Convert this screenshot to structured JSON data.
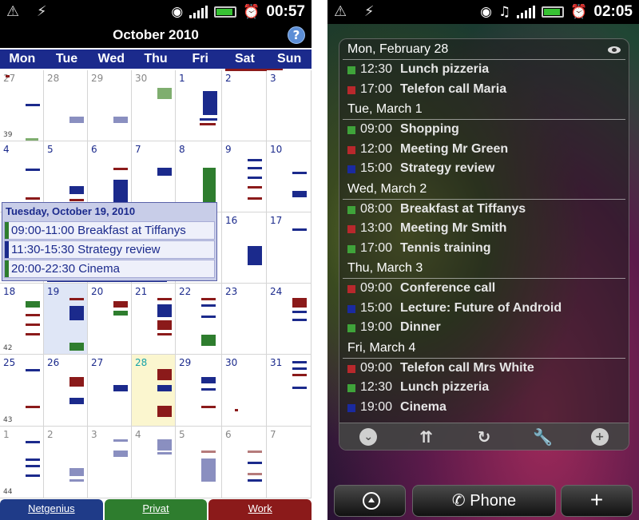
{
  "left": {
    "status": {
      "time": "00:57"
    },
    "month_title": "October 2010",
    "help_label": "?",
    "weekdays": [
      "Mon",
      "Tue",
      "Wed",
      "Thu",
      "Fri",
      "Sat",
      "Sun"
    ],
    "rows": [
      {
        "week": "39",
        "days": [
          "27",
          "28",
          "29",
          "30",
          "1",
          "2",
          "3"
        ]
      },
      {
        "week": "",
        "days": [
          "4",
          "5",
          "6",
          "7",
          "8",
          "9",
          "10"
        ]
      },
      {
        "week": "",
        "days": [
          "",
          "",
          "",
          "",
          "",
          "16",
          "17"
        ]
      },
      {
        "week": "42",
        "days": [
          "18",
          "19",
          "20",
          "21",
          "22",
          "23",
          "24"
        ]
      },
      {
        "week": "43",
        "days": [
          "25",
          "26",
          "27",
          "28",
          "29",
          "30",
          "31"
        ]
      },
      {
        "week": "44",
        "days": [
          "1",
          "2",
          "3",
          "4",
          "5",
          "6",
          "7"
        ]
      }
    ],
    "popup": {
      "title": "Tuesday, October 19, 2010",
      "events": [
        {
          "text": "09:00-11:00 Breakfast at Tiffanys",
          "color": "#2e7d2e"
        },
        {
          "text": "11:30-15:30 Strategy review",
          "color": "#1b2a8c"
        },
        {
          "text": "20:00-22:30 Cinema",
          "color": "#2e7d2e"
        }
      ]
    },
    "tabs": [
      "Netgenius",
      "Privat",
      "Work"
    ]
  },
  "right": {
    "status": {
      "time": "02:05"
    },
    "days": [
      {
        "title": "Mon, February 28",
        "events": [
          {
            "time": "12:30",
            "title": "Lunch pizzeria",
            "color": "g"
          },
          {
            "time": "17:00",
            "title": "Telefon call Maria",
            "color": "r"
          }
        ]
      },
      {
        "title": "Tue, March 1",
        "events": [
          {
            "time": "09:00",
            "title": "Shopping",
            "color": "g"
          },
          {
            "time": "12:00",
            "title": "Meeting Mr Green",
            "color": "r"
          },
          {
            "time": "15:00",
            "title": "Strategy review",
            "color": "b"
          }
        ]
      },
      {
        "title": "Wed, March 2",
        "events": [
          {
            "time": "08:00",
            "title": "Breakfast at Tiffanys",
            "color": "g"
          },
          {
            "time": "13:00",
            "title": "Meeting Mr Smith",
            "color": "r"
          },
          {
            "time": "17:00",
            "title": "Tennis training",
            "color": "g"
          }
        ]
      },
      {
        "title": "Thu, March 3",
        "events": [
          {
            "time": "09:00",
            "title": "Conference call",
            "color": "r"
          },
          {
            "time": "15:00",
            "title": "Lecture: Future of Android",
            "color": "b"
          },
          {
            "time": "19:00",
            "title": "Dinner",
            "color": "g"
          }
        ]
      },
      {
        "title": "Fri, March 4",
        "events": [
          {
            "time": "09:00",
            "title": "Telefon call Mrs White",
            "color": "r"
          },
          {
            "time": "12:30",
            "title": "Lunch pizzeria",
            "color": "g"
          },
          {
            "time": "19:00",
            "title": "Cinema",
            "color": "b"
          }
        ]
      }
    ],
    "dock": {
      "phone_label": "Phone",
      "plus_label": "+"
    }
  }
}
